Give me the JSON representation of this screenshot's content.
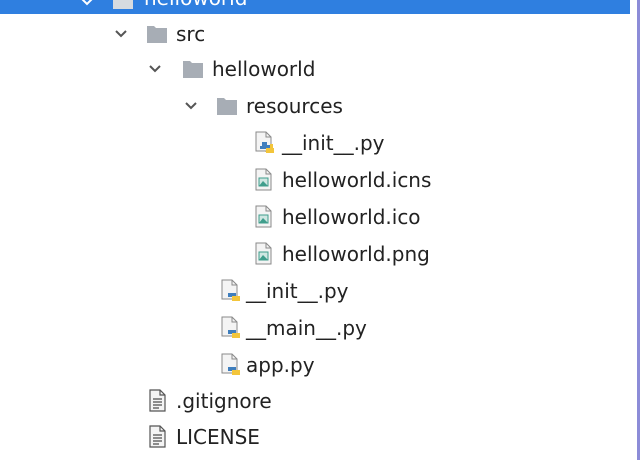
{
  "colors": {
    "selection": "#2f7fe0",
    "folder": "#a7adb5",
    "python_blue": "#3f7ebd",
    "python_yellow": "#f3c53b",
    "image_icon": "#3f9e8c"
  },
  "tree": {
    "root": {
      "label": "helloworld",
      "icon": "folder-icon",
      "expanded": true
    },
    "items": [
      {
        "label": "src",
        "icon": "folder-icon",
        "expanded": true
      },
      {
        "label": "helloworld",
        "icon": "folder-icon",
        "expanded": true
      },
      {
        "label": "resources",
        "icon": "folder-icon",
        "expanded": true
      },
      {
        "label": "__init__.py",
        "icon": "python-file-icon"
      },
      {
        "label": "helloworld.icns",
        "icon": "image-file-icon"
      },
      {
        "label": "helloworld.ico",
        "icon": "image-file-icon"
      },
      {
        "label": "helloworld.png",
        "icon": "image-file-icon"
      },
      {
        "label": "__init__.py",
        "icon": "python-file-icon"
      },
      {
        "label": "__main__.py",
        "icon": "python-file-icon"
      },
      {
        "label": "app.py",
        "icon": "python-file-icon"
      },
      {
        "label": ".gitignore",
        "icon": "text-file-icon"
      },
      {
        "label": "LICENSE",
        "icon": "text-file-icon"
      }
    ]
  }
}
